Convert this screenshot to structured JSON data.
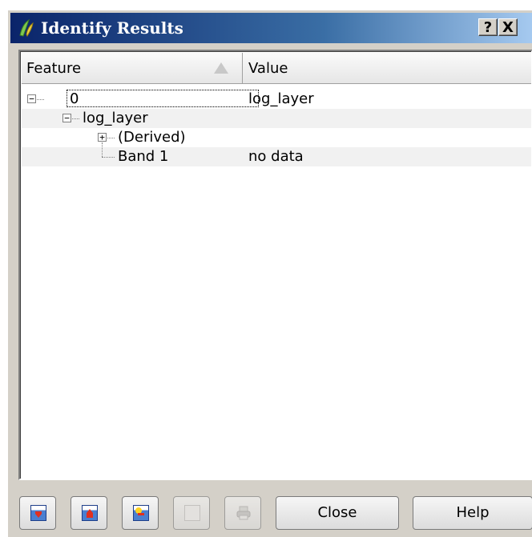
{
  "window": {
    "title": "Identify Results",
    "help_button": "?",
    "close_button": "X"
  },
  "columns": {
    "feature": "Feature",
    "value": "Value"
  },
  "tree": {
    "root": {
      "label": "0",
      "value": "log_layer"
    },
    "layer": {
      "label": "log_layer",
      "value": ""
    },
    "derived": {
      "label": "(Derived)",
      "value": ""
    },
    "band": {
      "label": "Band 1",
      "value": "no data"
    }
  },
  "buttons": {
    "close": "Close",
    "help": "Help"
  },
  "icons": {
    "expand_all": "expand-all-icon",
    "collapse_all": "collapse-all-icon",
    "expand_new": "expand-new-icon",
    "copy": "copy-icon",
    "print": "print-icon"
  }
}
